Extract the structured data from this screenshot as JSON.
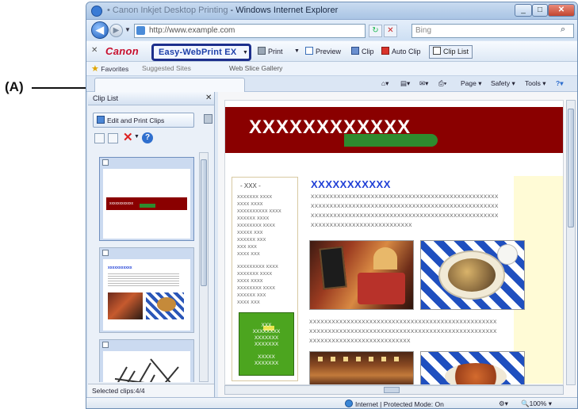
{
  "callout": {
    "label": "(A)"
  },
  "window": {
    "title": "Windows Internet Explorer",
    "title_prefix": "• Canon Inkjet Desktop Printing",
    "address": "http://www.example.com",
    "search_placeholder": "Bing"
  },
  "ewp_toolbar": {
    "brand": "Canon",
    "menu_label": "Easy-WebPrint EX",
    "print": "Print",
    "preview": "Preview",
    "clip": "Clip",
    "auto_clip": "Auto Clip",
    "clip_list": "Clip List"
  },
  "favorites": {
    "label": "Favorites",
    "item1": "Suggested Sites",
    "item2": "Web Slice Gallery"
  },
  "commands": {
    "page": "Page",
    "safety": "Safety",
    "tools": "Tools"
  },
  "clip_pane": {
    "title": "Clip List",
    "edit_button": "Edit and Print Clips",
    "selected": "Selected clips:4/4"
  },
  "web_page": {
    "banner": "XXXXXXXXXXXX",
    "heading": "XXXXXXXXXXX",
    "side_title": "- XXX -",
    "side_rows": [
      "XXXXXXX   XXXX",
      "XXXX   XXXX",
      "XXXXXXXXXX   XXXX",
      "XXXXXX   XXXX",
      "XXXXXXXX   XXXX",
      "XXXXX   XXX",
      "XXXXXX   XXX",
      "XXX   XXX",
      "XXXX   XXX",
      "XXXXXXXXX   XXXX",
      "XXXXXXX   XXXX",
      "XXXX   XXXX",
      "XXXXXXXX   XXXX",
      "XXXXXX   XXX",
      "XXXX   XXX"
    ],
    "green_box": "XXX\nXXXXXXXX\nXXXXXXX\nXXXXXXX\n\nXXXXX\nXXXXXXX",
    "text_line": "XXXXXXXXXXXXXXXXXXXXXXXXXXXXXXXXXXXXXXXXXXXXXXXXXX",
    "text_short": "XXXXXXXXXXXXXXXXXXXXXXXXXXX"
  },
  "statusbar": {
    "zone": "Internet | Protected Mode: On",
    "zoom": "100%"
  },
  "colors": {
    "banner": "#8a0000",
    "heading": "#1f3fd6",
    "highlight_border": "#1d2f8c"
  }
}
